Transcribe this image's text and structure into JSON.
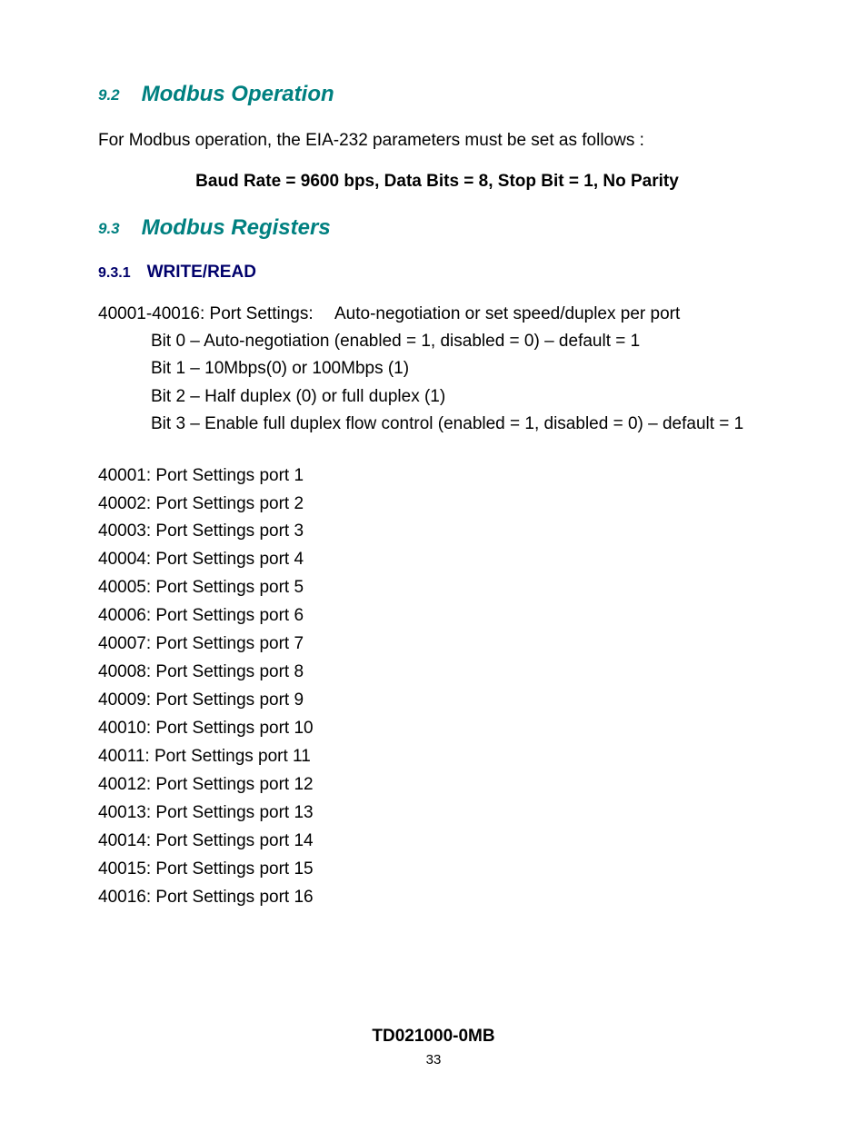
{
  "section92": {
    "num": "9.2",
    "title": "Modbus Operation",
    "intro": "For Modbus operation, the EIA-232 parameters must be set as follows :",
    "params": "Baud Rate = 9600 bps,   Data Bits = 8,   Stop Bit = 1,   No Parity"
  },
  "section93": {
    "num": "9.3",
    "title": "Modbus Registers",
    "sub": {
      "num": "9.3.1",
      "title": "WRITE/READ"
    },
    "reg_header_label": "40001-40016: Port Settings:",
    "reg_header_desc": "Auto-negotiation or set speed/duplex per port",
    "bits": [
      "Bit 0 – Auto-negotiation (enabled = 1, disabled = 0) – default = 1",
      "Bit 1 – 10Mbps(0) or 100Mbps (1)",
      "Bit 2 – Half duplex (0) or full duplex (1)",
      "Bit 3 – Enable full duplex flow control (enabled = 1, disabled = 0) – default = 1"
    ],
    "ports": [
      "40001: Port Settings port 1",
      "40002: Port Settings port 2",
      "40003: Port Settings port 3",
      "40004: Port Settings port 4",
      "40005: Port Settings port 5",
      "40006: Port Settings port 6",
      "40007: Port Settings port 7",
      "40008: Port Settings port 8",
      "40009: Port Settings port 9",
      "40010: Port Settings port 10",
      "40011: Port Settings port 11",
      "40012: Port Settings port 12",
      "40013: Port Settings port 13",
      "40014: Port Settings port 14",
      "40015: Port Settings port 15",
      "40016: Port Settings port 16"
    ]
  },
  "footer": {
    "doc_id": "TD021000-0MB",
    "page": "33"
  }
}
